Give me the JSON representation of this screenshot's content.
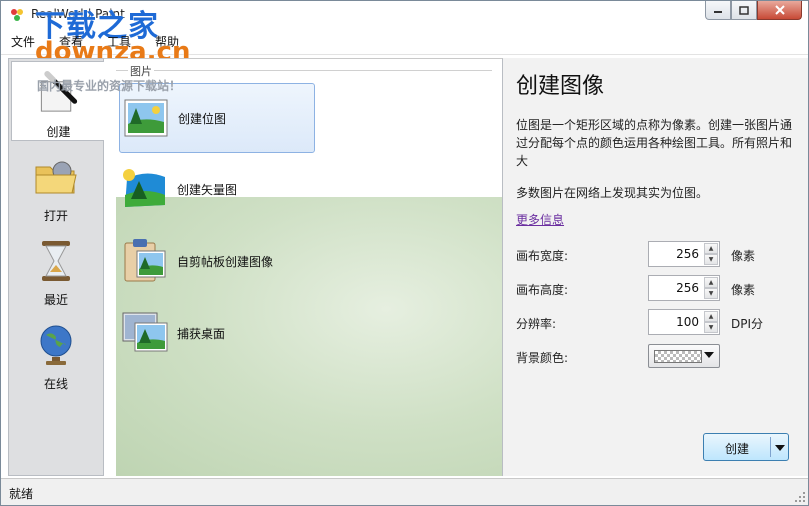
{
  "window": {
    "title": "RealWorld Paint",
    "watermark": {
      "brand": "下载之家",
      "url": "downza.cn",
      "slogan": "国内最专业的资源下载站！"
    }
  },
  "menu": [
    "文件",
    "查看",
    "工具",
    "帮助"
  ],
  "nav": [
    {
      "label": "创建",
      "icon": "paint-brush-icon",
      "active": true
    },
    {
      "label": "打开",
      "icon": "folder-open-icon",
      "active": false
    },
    {
      "label": "最近",
      "icon": "hourglass-icon",
      "active": false
    },
    {
      "label": "在线",
      "icon": "globe-icon",
      "active": false
    }
  ],
  "middle": {
    "group_header": "图片",
    "options": [
      {
        "label": "创建位图",
        "icon": "bitmap-picture-icon",
        "selected": true
      },
      {
        "label": "创建矢量图",
        "icon": "vector-picture-icon",
        "selected": false
      },
      {
        "label": "自剪帖板创建图像",
        "icon": "clipboard-picture-icon",
        "selected": false
      },
      {
        "label": "捕获桌面",
        "icon": "capture-desktop-icon",
        "selected": false
      }
    ]
  },
  "details": {
    "title": "创建图像",
    "description": "位图是一个矩形区域的点称为像素。创建一张图片通过分配每个点的颜色运用各种绘图工具。所有照片和大",
    "description2": "多数图片在网络上发现其实为位图。",
    "more_link": "更多信息",
    "fields": {
      "width": {
        "label": "画布宽度:",
        "value": "256",
        "unit": "像素"
      },
      "height": {
        "label": "画布高度:",
        "value": "256",
        "unit": "像素"
      },
      "resolution": {
        "label": "分辨率:",
        "value": "100",
        "unit": "DPI分"
      },
      "background": {
        "label": "背景颜色:",
        "value_icon": "transparent-checker-swatch"
      }
    },
    "create_button": "创建"
  },
  "status": {
    "text": "就绪"
  },
  "colors": {
    "accent": "#3c7fb1",
    "selection_fill": "#dce9f9",
    "panel_gray": "#f2f2f2",
    "nav_gray": "#dedfe1"
  }
}
